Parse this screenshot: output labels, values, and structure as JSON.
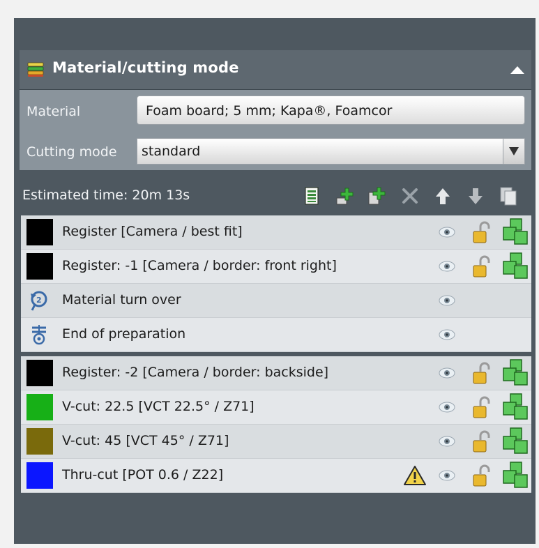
{
  "panel": {
    "title": "Material/cutting mode",
    "material_label": "Material",
    "material_value": "Foam board; 5 mm; Kapa®, Foamcor",
    "cutting_mode_label": "Cutting mode",
    "cutting_mode_value": "standard"
  },
  "toolbar": {
    "estimated_time": "Estimated time: 20m 13s",
    "icons": [
      "layer-list-icon",
      "add-item-icon",
      "add-layer-icon",
      "delete-icon",
      "move-up-icon",
      "move-down-icon",
      "copy-icon"
    ]
  },
  "rows": [
    {
      "label": "Register [Camera / best fit]",
      "swatch": "#000000",
      "icon": null,
      "lock": true,
      "cut": true,
      "warning": false
    },
    {
      "label": "Register: -1 [Camera / border: front right]",
      "swatch": "#000000",
      "icon": null,
      "lock": true,
      "cut": true,
      "warning": false
    },
    {
      "label": "Material turn over",
      "swatch": null,
      "icon": "turn-over-icon",
      "lock": false,
      "cut": false,
      "warning": false
    },
    {
      "label": "End of preparation",
      "swatch": null,
      "icon": "end-preparation-icon",
      "lock": false,
      "cut": false,
      "warning": false
    },
    {
      "label": "Register: -2 [Camera / border: backside]",
      "swatch": "#000000",
      "icon": null,
      "lock": true,
      "cut": true,
      "warning": false
    },
    {
      "label": "V-cut: 22.5 [VCT 22.5° / Z71]",
      "swatch": "#17b017",
      "icon": null,
      "lock": true,
      "cut": true,
      "warning": false
    },
    {
      "label": "V-cut: 45 [VCT 45° / Z71]",
      "swatch": "#7a6a0c",
      "icon": null,
      "lock": true,
      "cut": true,
      "warning": false
    },
    {
      "label": "Thru-cut [POT 0.6 / Z22]",
      "swatch": "#0b16ff",
      "icon": null,
      "lock": true,
      "cut": true,
      "warning": true
    }
  ],
  "colors": {
    "frame": "#4e5860",
    "header": "#5e6870",
    "settings": "#8a949c",
    "row_dark": "#d9dde0",
    "row_light": "#e4e7ea",
    "cut_green": "#3cb83c"
  }
}
